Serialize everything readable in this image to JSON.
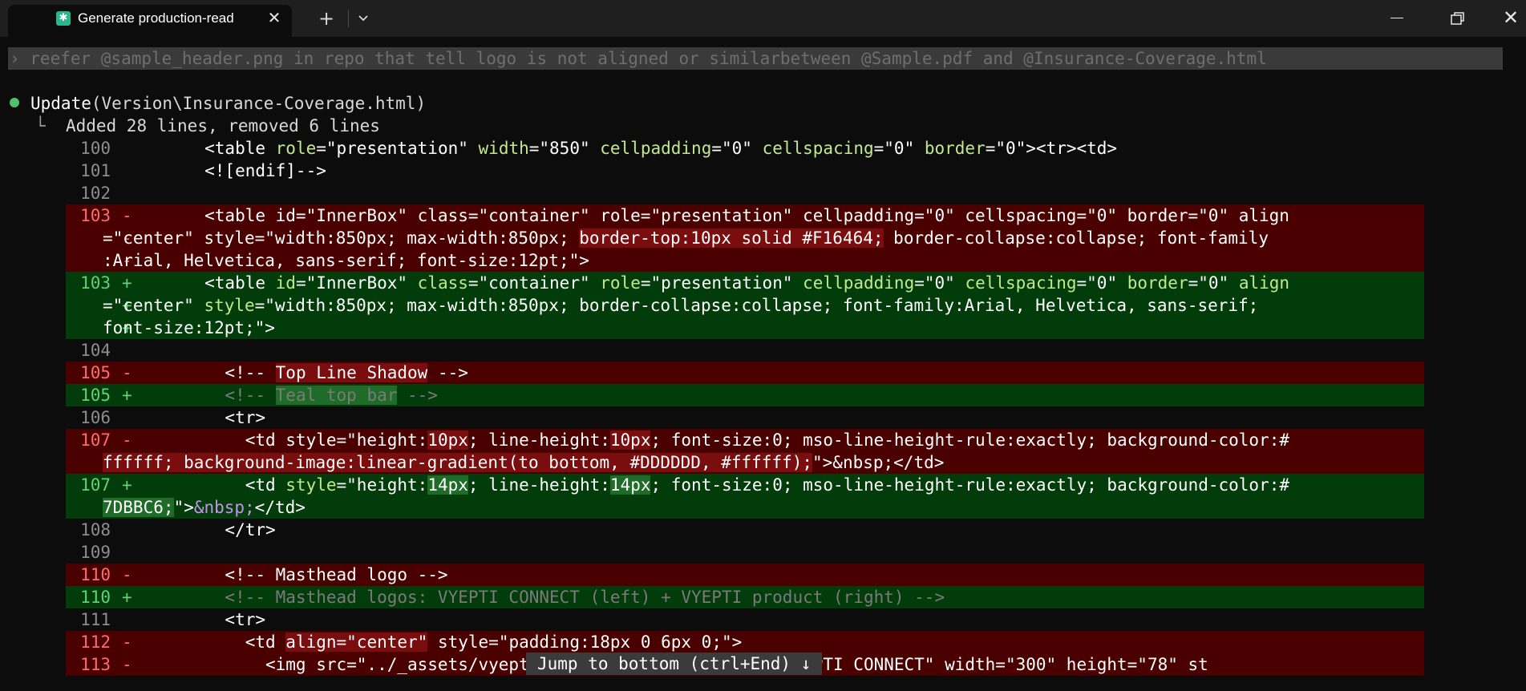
{
  "titlebar": {
    "tab_title": "Generate production-read",
    "tab_icon": "terminal-icon",
    "app_icon": "generate-icon",
    "close_glyph": "✕",
    "new_tab_glyph": "+",
    "dropdown_glyph": "⌄",
    "window_close_glyph": "✕"
  },
  "terminal": {
    "prompt": "› reefer @sample_header.png in repo that tell logo is not aligned or similarbetween @Sample.pdf and @Insurance-Coverage.html",
    "tool_call": "Update",
    "tool_arg": "(Version\\Insurance-Coverage.html)",
    "summary_branch": "└",
    "summary": "Added 28 lines, removed 6 lines",
    "jump_banner": "Jump to bottom (ctrl+End) ↓"
  },
  "diff_lines": [
    {
      "type": "ctx",
      "num": "100",
      "mark": "",
      "segs": [
        {
          "t": "        <table "
        },
        {
          "t": "role",
          "c": "at"
        },
        {
          "t": "=\"presentation\" "
        },
        {
          "t": "width",
          "c": "at"
        },
        {
          "t": "=\"850\" "
        },
        {
          "t": "cellpadding",
          "c": "at"
        },
        {
          "t": "=\"0\" "
        },
        {
          "t": "cellspacing",
          "c": "at"
        },
        {
          "t": "=\"0\" "
        },
        {
          "t": "border",
          "c": "at"
        },
        {
          "t": "=\"0\"><tr><td>"
        }
      ]
    },
    {
      "type": "ctx",
      "num": "101",
      "mark": "",
      "segs": [
        {
          "t": "        <![endif]-->"
        }
      ]
    },
    {
      "type": "ctx",
      "num": "102",
      "mark": "",
      "segs": [
        {
          "t": ""
        }
      ]
    },
    {
      "type": "del",
      "num": "103",
      "mark": "-",
      "segs": [
        {
          "t": "        <table id=\"InnerBox\" class=\"container\" role=\"presentation\" cellpadding=\"0\" cellspacing=\"0\" border=\"0\" align"
        }
      ]
    },
    {
      "type": "del",
      "num": "",
      "mark": "-",
      "segs": [
        {
          "t": "=\"center\" style=\"width:850px; max-width:850px; "
        },
        {
          "t": "border-top:10px solid #F16464;",
          "c": "hl-del"
        },
        {
          "t": " border-collapse:collapse; font-family"
        }
      ]
    },
    {
      "type": "del",
      "num": "",
      "mark": "-",
      "segs": [
        {
          "t": ":Arial, Helvetica, sans-serif; font-size:12pt;\">"
        }
      ]
    },
    {
      "type": "add",
      "num": "103",
      "mark": "+",
      "segs": [
        {
          "t": "        <table "
        },
        {
          "t": "id",
          "c": "at"
        },
        {
          "t": "=\"InnerBox\" "
        },
        {
          "t": "class",
          "c": "at"
        },
        {
          "t": "=\"container\" "
        },
        {
          "t": "role",
          "c": "at"
        },
        {
          "t": "=\"presentation\" "
        },
        {
          "t": "cellpadding",
          "c": "at"
        },
        {
          "t": "=\"0\" "
        },
        {
          "t": "cellspacing",
          "c": "at"
        },
        {
          "t": "=\"0\" "
        },
        {
          "t": "border",
          "c": "at"
        },
        {
          "t": "=\"0\" "
        },
        {
          "t": "align",
          "c": "at"
        }
      ]
    },
    {
      "type": "add",
      "num": "",
      "mark": "+",
      "segs": [
        {
          "t": "=\"center\" "
        },
        {
          "t": "style",
          "c": "at"
        },
        {
          "t": "=\"width:850px; max-width:850px; border-collapse:collapse; font-family:Arial, Helvetica, sans-serif;"
        }
      ]
    },
    {
      "type": "add",
      "num": "",
      "mark": "+",
      "segs": [
        {
          "t": "font-size:12pt;\">"
        }
      ]
    },
    {
      "type": "ctx",
      "num": "104",
      "mark": "",
      "segs": [
        {
          "t": ""
        }
      ]
    },
    {
      "type": "del",
      "num": "105",
      "mark": "-",
      "segs": [
        {
          "t": "          <!-- "
        },
        {
          "t": "Top Line Shadow",
          "c": "hl-del"
        },
        {
          "t": " -->"
        }
      ]
    },
    {
      "type": "add",
      "num": "105",
      "mark": "+",
      "segs": [
        {
          "t": "          <!-- ",
          "c": "cmt"
        },
        {
          "t": "Teal top bar",
          "c": "cmt hl-add"
        },
        {
          "t": " -->",
          "c": "cmt"
        }
      ]
    },
    {
      "type": "ctx",
      "num": "106",
      "mark": "",
      "segs": [
        {
          "t": "          <tr>"
        }
      ]
    },
    {
      "type": "del",
      "num": "107",
      "mark": "-",
      "segs": [
        {
          "t": "            <td style=\"height:"
        },
        {
          "t": "10px",
          "c": "hl-del"
        },
        {
          "t": "; line-height:"
        },
        {
          "t": "10px",
          "c": "hl-del"
        },
        {
          "t": "; font-size:0; mso-line-height-rule:exactly; background-color:#"
        }
      ]
    },
    {
      "type": "del",
      "num": "",
      "mark": "-",
      "segs": [
        {
          "t": "ffffff; background-image:linear-gradient(to bottom, #DDDDDD, #ffffff);",
          "c": "hl-del"
        },
        {
          "t": "\">&nbsp;</td>"
        }
      ]
    },
    {
      "type": "add",
      "num": "107",
      "mark": "+",
      "segs": [
        {
          "t": "            <td "
        },
        {
          "t": "style",
          "c": "at"
        },
        {
          "t": "=\"height:"
        },
        {
          "t": "14px",
          "c": "hl-add"
        },
        {
          "t": "; line-height:"
        },
        {
          "t": "14px",
          "c": "hl-add"
        },
        {
          "t": "; font-size:0; mso-line-height-rule:exactly; background-color:#"
        }
      ]
    },
    {
      "type": "add",
      "num": "",
      "mark": "+",
      "segs": [
        {
          "t": "7DBBC6;",
          "c": "hl-add"
        },
        {
          "t": "\">"
        },
        {
          "t": "&nbsp;",
          "c": "ent"
        },
        {
          "t": "</td>"
        }
      ]
    },
    {
      "type": "ctx",
      "num": "108",
      "mark": "",
      "segs": [
        {
          "t": "          </tr>"
        }
      ]
    },
    {
      "type": "ctx",
      "num": "109",
      "mark": "",
      "segs": [
        {
          "t": ""
        }
      ]
    },
    {
      "type": "del",
      "num": "110",
      "mark": "-",
      "segs": [
        {
          "t": "          <!-- Masthead logo -->"
        }
      ]
    },
    {
      "type": "add",
      "num": "110",
      "mark": "+",
      "segs": [
        {
          "t": "          <!-- Masthead logos: VYEPTI CONNECT (left) + VYEPTI product (right) -->",
          "c": "cmt"
        }
      ]
    },
    {
      "type": "ctx",
      "num": "111",
      "mark": "",
      "segs": [
        {
          "t": "          <tr>"
        }
      ]
    },
    {
      "type": "del",
      "num": "112",
      "mark": "-",
      "segs": [
        {
          "t": "            <td "
        },
        {
          "t": "align=\"center\"",
          "c": "hl-del"
        },
        {
          "t": " style=\"padding:18px 0 6px 0;\">"
        }
      ]
    },
    {
      "type": "del",
      "num": "113",
      "mark": "-",
      "segs": [
        {
          "t": "              <img src=\"../_assets/vyepti-connect-logo.png\" alt=\"VYEPTI CONNECT\" width=\"300\" height=\"78\" st"
        }
      ]
    }
  ],
  "colors": {
    "terminal_bg": "#0c0c0c",
    "titlebar_bg": "#1f1f1f",
    "deleted_bg": "#4b0000",
    "added_bg": "#023c0a",
    "attribute": "#c3e88d",
    "status_dot": "#4ec26f"
  }
}
